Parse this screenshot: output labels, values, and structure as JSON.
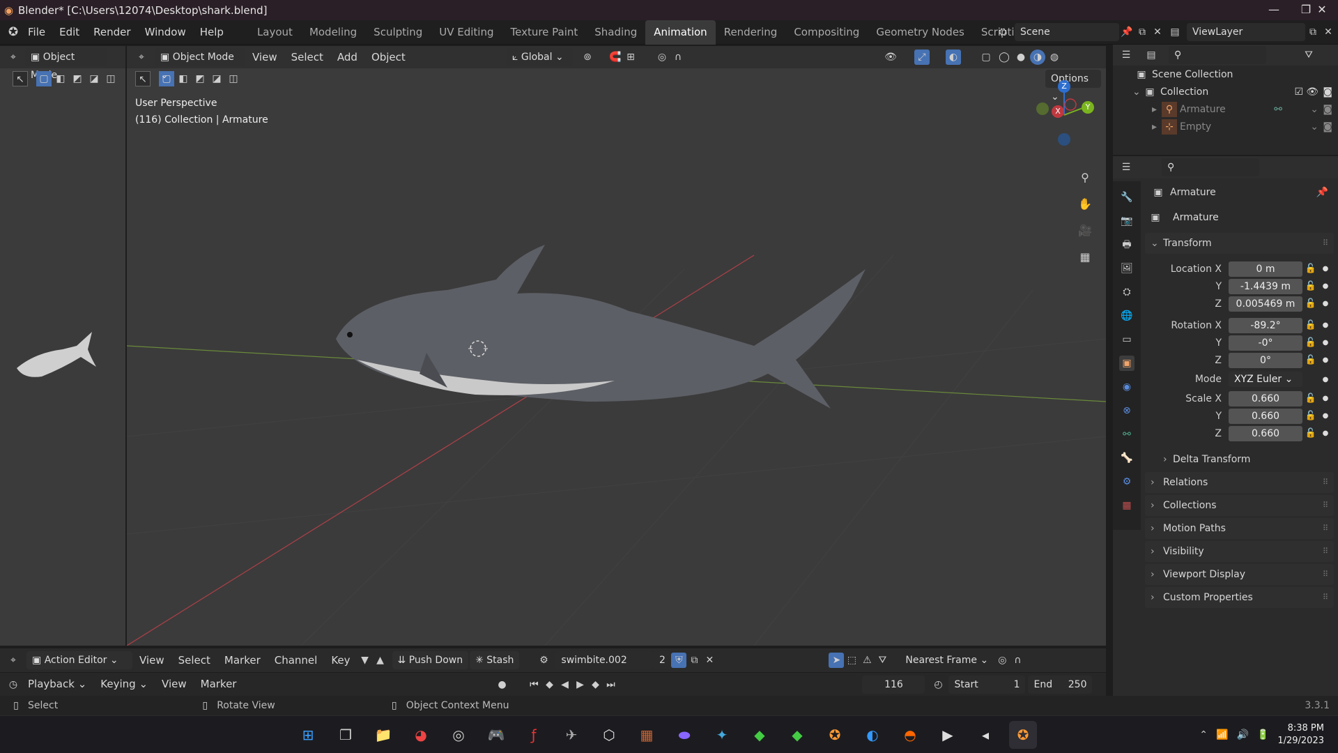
{
  "titlebar": {
    "title": "Blender* [C:\\Users\\12074\\Desktop\\shark.blend]",
    "minimize": "—",
    "maximize": "❐",
    "close": "✕"
  },
  "menu": {
    "items": [
      "File",
      "Edit",
      "Render",
      "Window",
      "Help"
    ]
  },
  "workspaces": {
    "tabs": [
      "Layout",
      "Modeling",
      "Sculpting",
      "UV Editing",
      "Texture Paint",
      "Shading",
      "Animation",
      "Rendering",
      "Compositing",
      "Geometry Nodes",
      "Scripting"
    ],
    "active": "Animation",
    "add": "+"
  },
  "scene": {
    "name": "Scene"
  },
  "viewlayer": {
    "name": "ViewLayer"
  },
  "left_view": {
    "mode": "Object Mode"
  },
  "viewport": {
    "mode": "Object Mode",
    "menus": [
      "View",
      "Select",
      "Add",
      "Object"
    ],
    "transform_orientation": "Global",
    "options": "Options",
    "overlay_title": "User Perspective",
    "overlay_sub": "(116) Collection | Armature",
    "gizmo": {
      "z": "Z",
      "x": "X",
      "y": "Y"
    }
  },
  "outliner": {
    "root": "Scene Collection",
    "collection": "Collection",
    "items": [
      "Armature",
      "Empty"
    ]
  },
  "properties": {
    "object_name": "Armature",
    "data_name": "Armature",
    "transform_title": "Transform",
    "location": {
      "label": "Location X",
      "x": "0 m",
      "y": "-1.4439 m",
      "z": "0.005469 m"
    },
    "rotation": {
      "label": "Rotation X",
      "x": "-89.2°",
      "y": "-0°",
      "z": "0°"
    },
    "mode": {
      "label": "Mode",
      "value": "XYZ Euler"
    },
    "scale": {
      "label": "Scale X",
      "x": "0.660",
      "y": "0.660",
      "z": "0.660"
    },
    "axis_y": "Y",
    "axis_z": "Z",
    "delta": "Delta Transform",
    "sections": [
      "Relations",
      "Collections",
      "Motion Paths",
      "Visibility",
      "Viewport Display",
      "Custom Properties"
    ]
  },
  "action_editor": {
    "mode": "Action Editor",
    "menus": [
      "View",
      "Select",
      "Marker",
      "Channel",
      "Key"
    ],
    "push_down": "Push Down",
    "stash": "Stash",
    "action": "swimbite.002",
    "users": "2",
    "snap": "Nearest Frame"
  },
  "timeline": {
    "menus": [
      "Playback",
      "Keying",
      "View",
      "Marker"
    ],
    "frame": "116",
    "start_label": "Start",
    "start": "1",
    "end_label": "End",
    "end": "250"
  },
  "status": {
    "select": "Select",
    "rotate": "Rotate View",
    "context": "Object Context Menu",
    "version": "3.3.1"
  },
  "taskbar": {
    "time": "8:38 PM",
    "date": "1/29/2023"
  },
  "colors": {
    "accent": "#4772b3",
    "x_axis": "#c0383f",
    "y_axis": "#7ab41e",
    "z_axis": "#2d6fd0"
  }
}
